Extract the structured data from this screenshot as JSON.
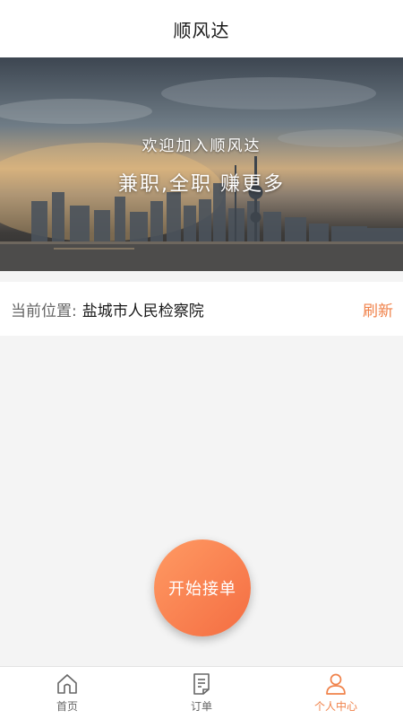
{
  "header": {
    "title": "顺风达"
  },
  "banner": {
    "line1": "欢迎加入顺风达",
    "line2": "兼职,全职 赚更多"
  },
  "location": {
    "label": "当前位置:",
    "value": "盐城市人民检察院",
    "refresh_label": "刷新"
  },
  "start_button": {
    "label": "开始接单"
  },
  "tabbar": {
    "items": [
      {
        "label": "首页",
        "icon": "home-icon",
        "active": false
      },
      {
        "label": "订单",
        "icon": "order-icon",
        "active": false
      },
      {
        "label": "个人中心",
        "icon": "user-icon",
        "active": true
      }
    ]
  },
  "colors": {
    "accent": "#f0824a",
    "button_gradient_start": "#ff9a63",
    "button_gradient_end": "#f46d42",
    "background": "#f4f4f4"
  }
}
